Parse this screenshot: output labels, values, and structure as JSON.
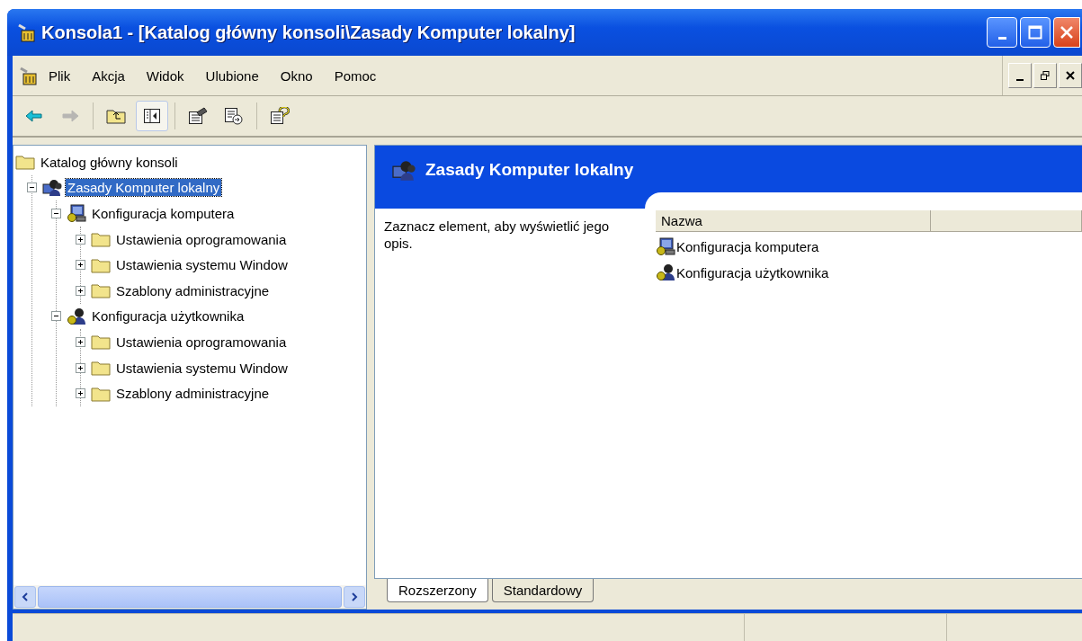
{
  "window": {
    "title": "Konsola1 - [Katalog główny konsoli\\Zasady Komputer lokalny]"
  },
  "menu": {
    "items": [
      "Plik",
      "Akcja",
      "Widok",
      "Ulubione",
      "Okno",
      "Pomoc"
    ]
  },
  "toolbar": [
    {
      "kind": "back",
      "disabled": false,
      "pressed": false
    },
    {
      "kind": "forward",
      "disabled": true,
      "pressed": false
    },
    {
      "kind": "up",
      "disabled": false,
      "pressed": false
    },
    {
      "kind": "tree",
      "disabled": false,
      "pressed": true
    },
    {
      "kind": "properties",
      "disabled": false,
      "pressed": false
    },
    {
      "kind": "export",
      "disabled": false,
      "pressed": false
    },
    {
      "kind": "help",
      "disabled": false,
      "pressed": false
    }
  ],
  "tree": {
    "label": "Katalog główny konsoli",
    "kind": "folder",
    "selected": false,
    "children": [
      {
        "label": "Zasady Komputer lokalny",
        "kind": "policy",
        "expanded": true,
        "selected": true,
        "children": [
          {
            "label": "Konfiguracja komputera",
            "kind": "computer",
            "expanded": true,
            "selected": false,
            "children": [
              {
                "label": "Ustawienia oprogramowania",
                "kind": "folder",
                "expanded": false,
                "selected": false
              },
              {
                "label": "Ustawienia systemu Window",
                "kind": "folder",
                "expanded": false,
                "selected": false
              },
              {
                "label": "Szablony administracyjne",
                "kind": "folder",
                "expanded": false,
                "selected": false
              }
            ]
          },
          {
            "label": "Konfiguracja użytkownika",
            "kind": "user",
            "expanded": true,
            "selected": false,
            "children": [
              {
                "label": "Ustawienia oprogramowania",
                "kind": "folder",
                "expanded": false,
                "selected": false
              },
              {
                "label": "Ustawienia systemu Window",
                "kind": "folder",
                "expanded": false,
                "selected": false
              },
              {
                "label": "Szablony administracyjne",
                "kind": "folder",
                "expanded": false,
                "selected": false
              }
            ]
          }
        ]
      }
    ]
  },
  "details": {
    "title": "Zasady Komputer lokalny",
    "description": "Zaznacz element, aby wyświetlić jego opis.",
    "columns": [
      "Nazwa"
    ],
    "items": [
      {
        "name": "Konfiguracja komputera",
        "kind": "computer"
      },
      {
        "name": "Konfiguracja użytkownika",
        "kind": "user"
      }
    ]
  },
  "tabs": [
    {
      "label": "Rozszerzony",
      "selected": true
    },
    {
      "label": "Standardowy",
      "selected": false
    }
  ]
}
